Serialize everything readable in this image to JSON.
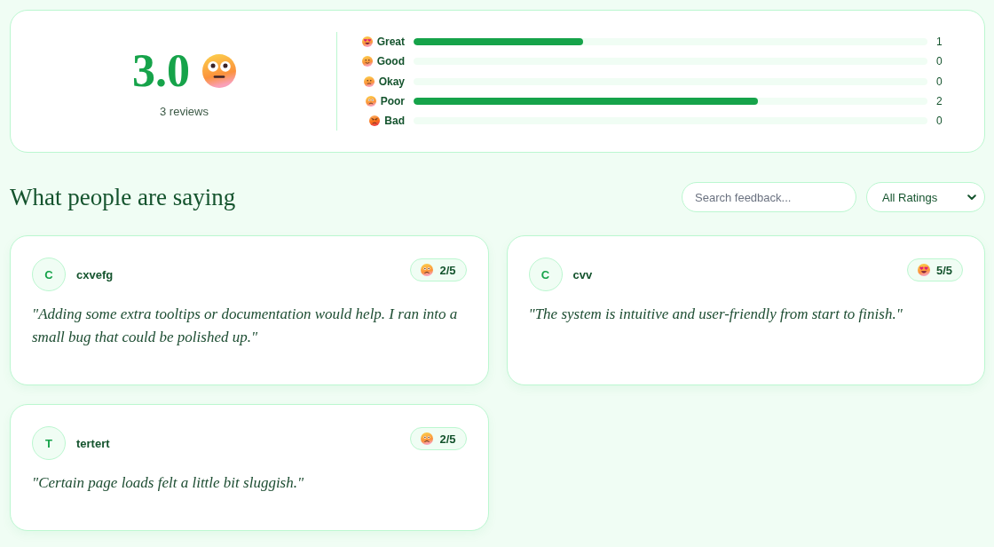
{
  "summary": {
    "score": "3.0",
    "kind": "neutral",
    "count_label": "3 reviews"
  },
  "distribution": [
    {
      "kind": "great",
      "label": "Great",
      "level": 0.33,
      "count": "1"
    },
    {
      "kind": "good",
      "label": "Good",
      "count": "0"
    },
    {
      "kind": "okay",
      "label": "Okay",
      "count": "0"
    },
    {
      "kind": "poor",
      "label": "Poor",
      "level": 0.67,
      "count": "2"
    },
    {
      "kind": "bad",
      "label": "Bad",
      "count": "0"
    }
  ],
  "section": {
    "title": "What people are saying",
    "search": {
      "placeholder": "Search feedback..."
    },
    "filter": {
      "value": "All Ratings"
    }
  },
  "reviews": [
    {
      "initial": "C",
      "name": "cxvefg",
      "kind": "poor",
      "rating": "2/5",
      "quote": "\"Adding some extra tooltips or documentation would help. I ran into a small bug that could be polished up.\""
    },
    {
      "initial": "C",
      "name": "cvv",
      "kind": "great",
      "rating": "5/5",
      "quote": "\"The system is intuitive and user-friendly from start to finish.\""
    },
    {
      "initial": "T",
      "name": "tertert",
      "kind": "poor",
      "rating": "2/5",
      "quote": "\"Certain page loads felt a little bit sluggish.\""
    }
  ]
}
